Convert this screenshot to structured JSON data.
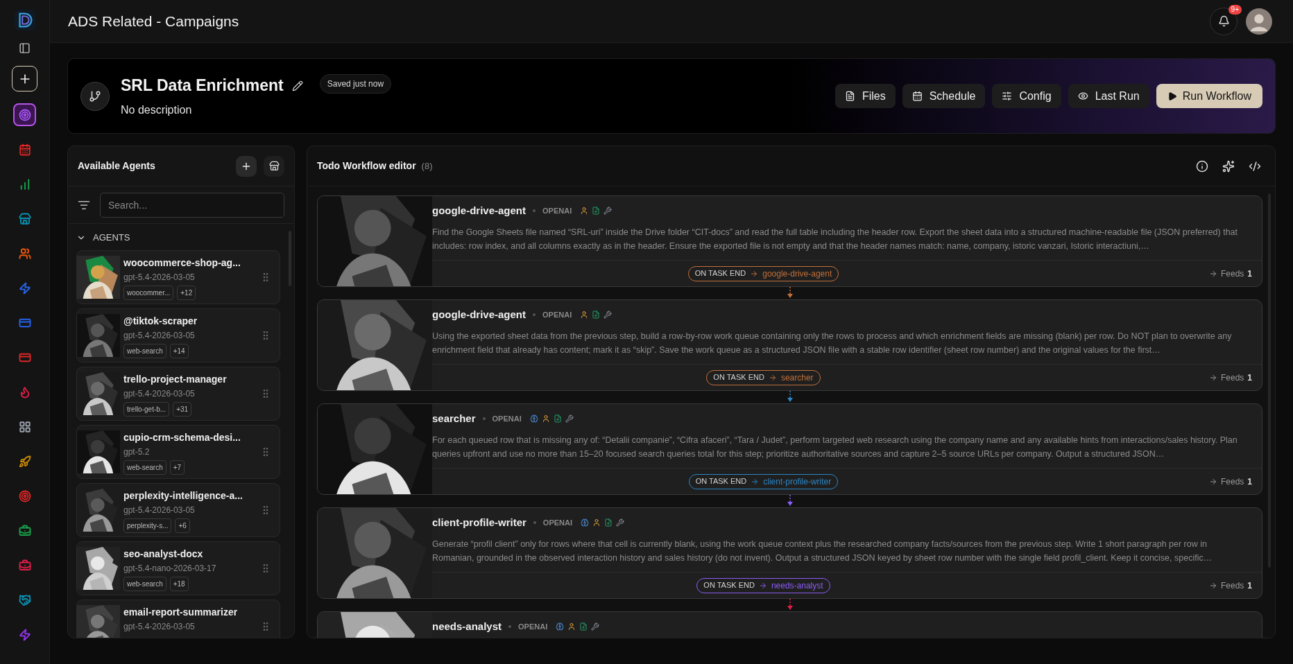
{
  "sidebar": {
    "items": [
      {
        "kind": "target",
        "color": "#a855f7",
        "selected": true
      },
      {
        "kind": "calendar",
        "color": "#dc2626",
        "selected": false
      },
      {
        "kind": "chart",
        "color": "#16a34a",
        "selected": false
      },
      {
        "kind": "store",
        "color": "#0891b2",
        "selected": false
      },
      {
        "kind": "users",
        "color": "#ea580c",
        "selected": false
      },
      {
        "kind": "zap",
        "color": "#2563eb",
        "selected": false
      },
      {
        "kind": "card",
        "color": "#2563eb",
        "selected": false
      },
      {
        "kind": "card",
        "color": "#dc2626",
        "selected": false
      },
      {
        "kind": "flame",
        "color": "#e11d48",
        "selected": false
      },
      {
        "kind": "grid",
        "color": "#9ca3af",
        "selected": false
      },
      {
        "kind": "rocket",
        "color": "#ca8a04",
        "selected": false
      },
      {
        "kind": "target",
        "color": "#dc2626",
        "selected": false
      },
      {
        "kind": "briefcase",
        "color": "#16a34a",
        "selected": false
      },
      {
        "kind": "briefcase",
        "color": "#e11d48",
        "selected": false
      },
      {
        "kind": "handshake",
        "color": "#0891b2",
        "selected": false
      },
      {
        "kind": "zap",
        "color": "#9333ea",
        "selected": false
      }
    ]
  },
  "topbar": {
    "title": "ADS Related - Campaigns",
    "notification_count": "9+"
  },
  "workflow": {
    "title": "SRL Data Enrichment",
    "description": "No description",
    "save_status": "Saved just now",
    "actions": [
      {
        "label": "Files",
        "kind": "files"
      },
      {
        "label": "Schedule",
        "kind": "schedule"
      },
      {
        "label": "Config",
        "kind": "config"
      },
      {
        "label": "Last Run",
        "kind": "last_run"
      },
      {
        "label": "Run Workflow",
        "kind": "run"
      }
    ]
  },
  "agents_panel": {
    "title": "Available Agents",
    "search": {
      "placeholder": "Search..."
    },
    "section": {
      "label": "AGENTS",
      "expanded": true
    },
    "agents": [
      {
        "name": "woocommerce-shop-ag...",
        "model": "gpt-5.4-2026-03-05",
        "tag": "woocommer...",
        "more": "+12"
      },
      {
        "name": "@tiktok-scraper",
        "model": "gpt-5.4-2026-03-05",
        "tag": "web-search",
        "more": "+14"
      },
      {
        "name": "trello-project-manager",
        "model": "gpt-5.4-2026-03-05",
        "tag": "trello-get-b...",
        "more": "+31"
      },
      {
        "name": "cupio-crm-schema-desi...",
        "model": "gpt-5.2",
        "tag": "web-search",
        "more": "+7"
      },
      {
        "name": "perplexity-intelligence-a...",
        "model": "gpt-5.4-2026-03-05",
        "tag": "perplexity-s...",
        "more": "+6"
      },
      {
        "name": "seo-analyst-docx",
        "model": "gpt-5.4-nano-2026-03-17",
        "tag": "web-search",
        "more": "+18"
      },
      {
        "name": "email-report-summarizer",
        "model": "gpt-5.4-2026-03-05"
      }
    ]
  },
  "editor": {
    "title": "Todo Workflow editor",
    "count": "(8)",
    "steps": [
      {
        "name": "google-drive-agent",
        "provider": "OPENAI",
        "color": "#c2703a",
        "tools": [
          {
            "kind": "user"
          },
          {
            "kind": "file"
          },
          {
            "kind": "wrench"
          }
        ],
        "description": "Find the Google Sheets file named “SRL-uri” inside the Drive folder “CIT-docs” and read the full table including the header row. Export the sheet data into a structured machine-readable file (JSON preferred) that includes: row index, and all columns exactly as in the header. Ensure the exported file is not empty and that the header names match: name, company, istoric vanzari, Istoric interactiuni,…",
        "trigger": "ON TASK END",
        "target": "google-drive-agent",
        "feeds_label": "Feeds",
        "feeds": "1"
      },
      {
        "name": "google-drive-agent",
        "provider": "OPENAI",
        "color": "#c2703a",
        "tools": [
          {
            "kind": "user"
          },
          {
            "kind": "file"
          },
          {
            "kind": "wrench"
          }
        ],
        "description": "Using the exported sheet data from the previous step, build a row-by-row work queue containing only the rows to process and which enrichment fields are missing (blank) per row. Do NOT plan to overwrite any enrichment field that already has content; mark it as “skip”. Save the work queue as a structured JSON file with a stable row identifier (sheet row number) and the original values for the first…",
        "trigger": "ON TASK END",
        "target": "searcher",
        "feeds_label": "Feeds",
        "feeds": "1"
      },
      {
        "name": "searcher",
        "provider": "OPENAI",
        "color": "#2b86c5",
        "tools": [
          {
            "kind": "brain"
          },
          {
            "kind": "user"
          },
          {
            "kind": "file"
          },
          {
            "kind": "wrench"
          }
        ],
        "description": "For each queued row that is missing any of: “Detalii companie”, “Cifra afaceri”, “Tara / Judet”, perform targeted web research using the company name and any available hints from interactions/sales history. Plan queries upfront and use no more than 15–20 focused search queries total for this step; prioritize authoritative sources and capture 2–5 source URLs per company. Output a structured JSON…",
        "trigger": "ON TASK END",
        "target": "client-profile-writer",
        "feeds_label": "Feeds",
        "feeds": "1"
      },
      {
        "name": "client-profile-writer",
        "provider": "OPENAI",
        "color": "#8b5cf6",
        "tools": [
          {
            "kind": "brain"
          },
          {
            "kind": "user"
          },
          {
            "kind": "file"
          },
          {
            "kind": "wrench"
          }
        ],
        "description": "Generate “profil client” only for rows where that cell is currently blank, using the work queue context plus the researched company facts/sources from the previous step. Write 1 short paragraph per row in Romanian, grounded in the observed interaction history and sales history (do not invent). Output a structured JSON keyed by sheet row number with the single field profil_client. Keep it concise, specific…",
        "trigger": "ON TASK END",
        "target": "needs-analyst",
        "feeds_label": "Feeds",
        "feeds": "1"
      },
      {
        "name": "needs-analyst",
        "provider": "OPENAI",
        "color": "#e11d48",
        "tools": [
          {
            "kind": "brain"
          },
          {
            "kind": "user"
          },
          {
            "kind": "file"
          },
          {
            "kind": "wrench"
          }
        ]
      }
    ]
  }
}
